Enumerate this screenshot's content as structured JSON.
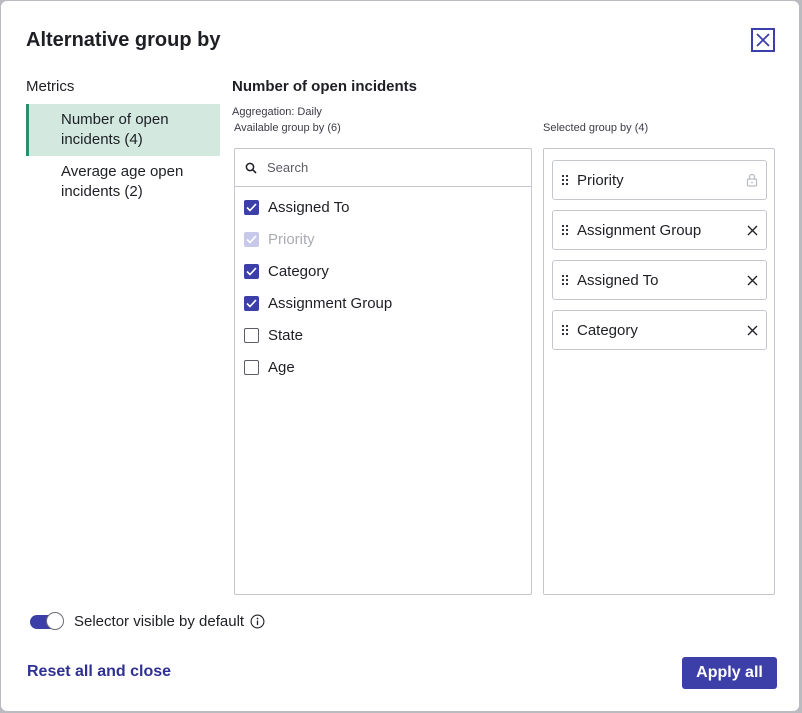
{
  "dialog": {
    "title": "Alternative group by"
  },
  "metrics": {
    "heading": "Metrics",
    "items": [
      {
        "label": "Number of open incidents (4)",
        "active": true
      },
      {
        "label": "Average age open incidents (2)",
        "active": false
      }
    ]
  },
  "panel": {
    "title": "Number of open incidents",
    "aggregation": "Aggregation: Daily",
    "available_label": "Available group by (6)",
    "selected_label": "Selected group by (4)",
    "search_placeholder": "Search",
    "options": [
      {
        "label": "Assigned To",
        "checked": true,
        "disabled": false
      },
      {
        "label": "Priority",
        "checked": true,
        "disabled": true
      },
      {
        "label": "Category",
        "checked": true,
        "disabled": false
      },
      {
        "label": "Assignment Group",
        "checked": true,
        "disabled": false
      },
      {
        "label": "State",
        "checked": false,
        "disabled": false
      },
      {
        "label": "Age",
        "checked": false,
        "disabled": false
      }
    ],
    "selected": [
      {
        "label": "Priority",
        "action_icon": "lock-icon"
      },
      {
        "label": "Assignment Group",
        "action_icon": "remove-icon"
      },
      {
        "label": "Assigned To",
        "action_icon": "remove-icon"
      },
      {
        "label": "Category",
        "action_icon": "remove-icon"
      }
    ]
  },
  "footer": {
    "toggle_label": "Selector visible by default",
    "toggle_on": true,
    "reset_label": "Reset all and close",
    "apply_label": "Apply all"
  },
  "colors": {
    "primary": "#3c3fa8",
    "active_bg": "#d3e8df",
    "active_border": "#2e8c6e",
    "border": "#c4c7cc"
  }
}
